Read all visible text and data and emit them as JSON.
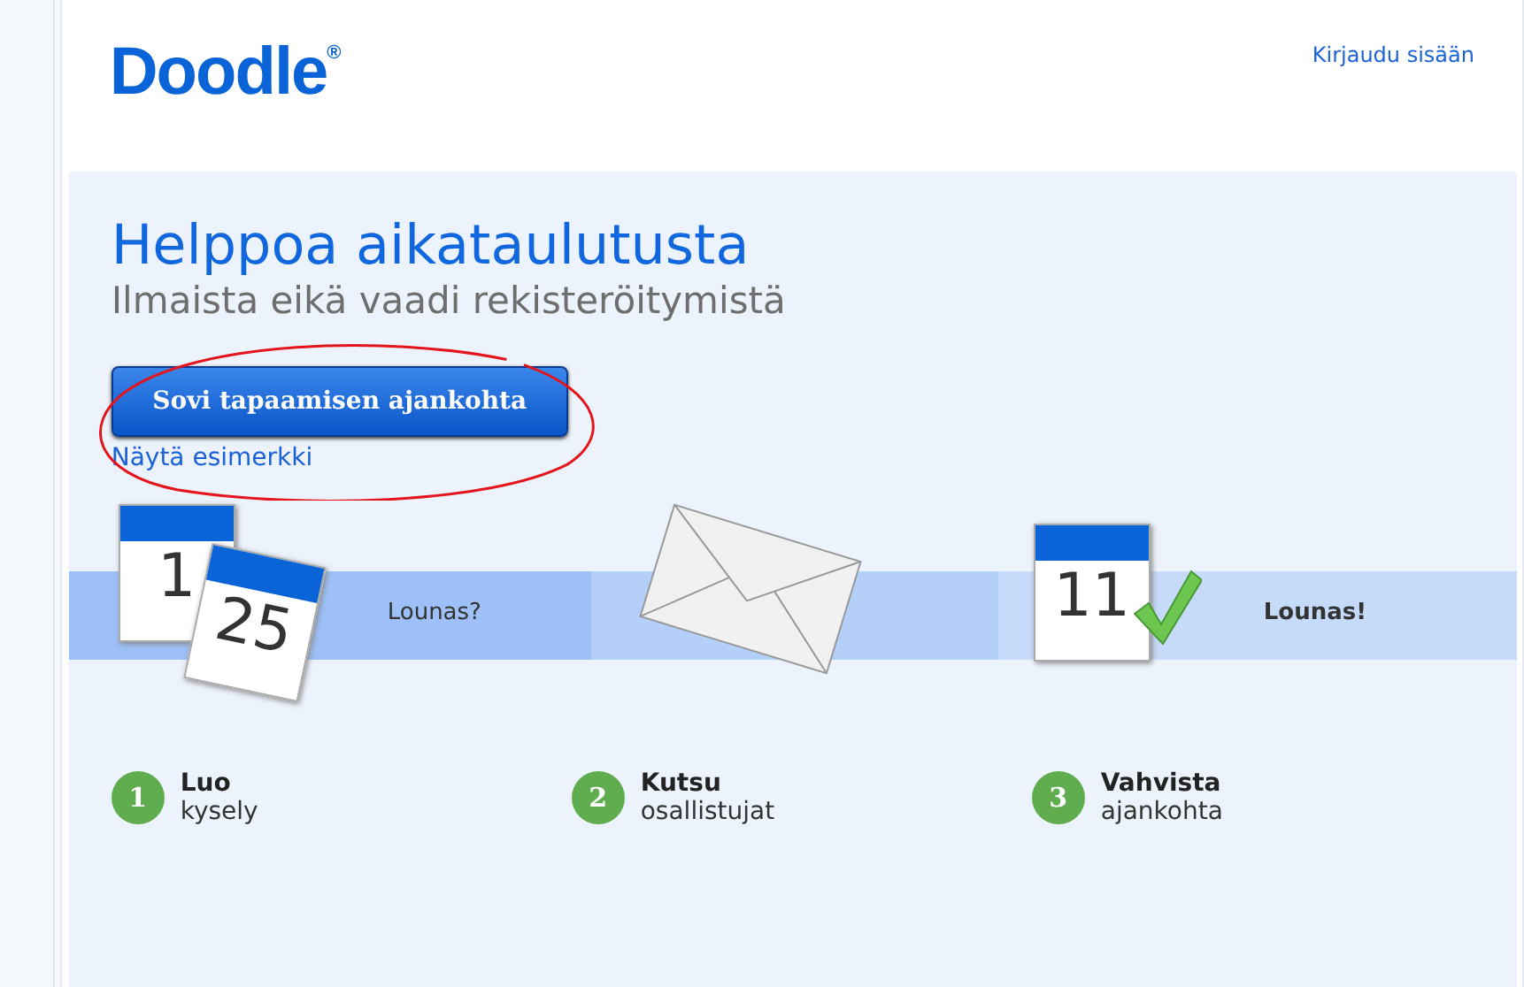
{
  "header": {
    "logo": "Doodle",
    "logo_mark": "®",
    "login_link": "Kirjaudu sisään"
  },
  "hero": {
    "title": "Helppoa aikataulutusta",
    "subtitle": "Ilmaista eikä vaadi rekisteröitymistä",
    "cta_button": "Sovi tapaamisen ajankohta",
    "example_link": "Näytä esimerkki",
    "highlighted": true
  },
  "banner": [
    {
      "kind": "calendars",
      "digits": [
        "1",
        "25"
      ],
      "caption": "Lounas?"
    },
    {
      "kind": "envelope"
    },
    {
      "kind": "confirmed",
      "digits": [
        "11"
      ],
      "caption": "Lounas!"
    }
  ],
  "steps": [
    {
      "number": "1",
      "title": "Luo",
      "subtitle": "kysely"
    },
    {
      "number": "2",
      "title": "Kutsu",
      "subtitle": "osallistujat"
    },
    {
      "number": "3",
      "title": "Vahvista",
      "subtitle": "ajankohta"
    }
  ]
}
